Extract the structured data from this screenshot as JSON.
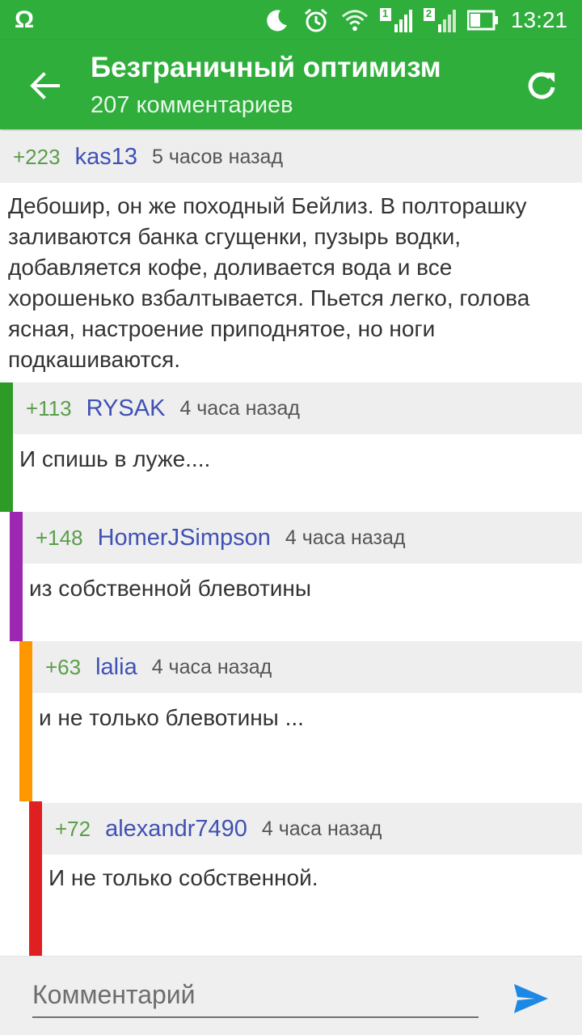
{
  "status_bar": {
    "left_icon": "notification-omega-icon",
    "left_glyph": "Ω",
    "time": "13:21",
    "icons": [
      "moon-icon",
      "alarm-icon",
      "wifi-icon",
      "signal-1-icon",
      "signal-2-icon",
      "battery-icon"
    ],
    "sim1": "1",
    "sim2": "2"
  },
  "app_bar": {
    "title": "Безграничный оптимизм",
    "subtitle": "207 комментариев",
    "back_icon": "arrow-back-icon",
    "refresh_icon": "refresh-icon"
  },
  "comments": [
    {
      "score": "+223",
      "author": "kas13",
      "time": "5 часов назад",
      "text": "Дебошир, он же походный Бейлиз. В полторашку заливаются банка сгущенки, пузырь водки, добавляется кофе, доливается вода и все хорошенько взбалтывается. Пьется легко, голова ясная, настроение приподнятое, но ноги подкашиваются.",
      "depth_color": ""
    },
    {
      "score": "+113",
      "author": "RYSAK",
      "time": "4 часа назад",
      "text": "И спишь в луже....",
      "depth_color": "#2e9a28"
    },
    {
      "score": "+148",
      "author": "HomerJSimpson",
      "time": "4 часа назад",
      "text": "из собственной блевотины",
      "depth_color": "#9c27b0"
    },
    {
      "score": "+63",
      "author": "lalia",
      "time": "4 часа назад",
      "text": "и не только блевотины ...",
      "depth_color": "#ff9800"
    },
    {
      "score": "+72",
      "author": "alexandr7490",
      "time": "4 часа назад",
      "text": "И не только собственной.",
      "depth_color": "#e02020"
    }
  ],
  "input": {
    "placeholder": "Комментарий",
    "send_icon": "send-icon"
  },
  "colors": {
    "accent": "#2fae3c",
    "author_link": "#3f51b5",
    "score": "#5a9e4a",
    "send": "#1e88e5"
  }
}
